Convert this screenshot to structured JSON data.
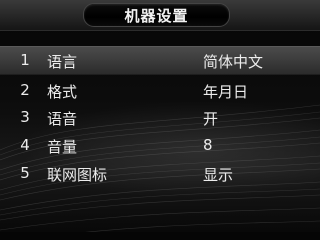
{
  "header": {
    "title": "机器设置"
  },
  "menu": {
    "items": [
      {
        "index": "1",
        "label": "语言",
        "value": "简体中文",
        "selected": true
      },
      {
        "index": "2",
        "label": "格式",
        "value": "年月日",
        "selected": false
      },
      {
        "index": "3",
        "label": "语音",
        "value": "开",
        "selected": false
      },
      {
        "index": "4",
        "label": "音量",
        "value": "8",
        "selected": false
      },
      {
        "index": "5",
        "label": "联网图标",
        "value": "显示",
        "selected": false
      }
    ]
  }
}
